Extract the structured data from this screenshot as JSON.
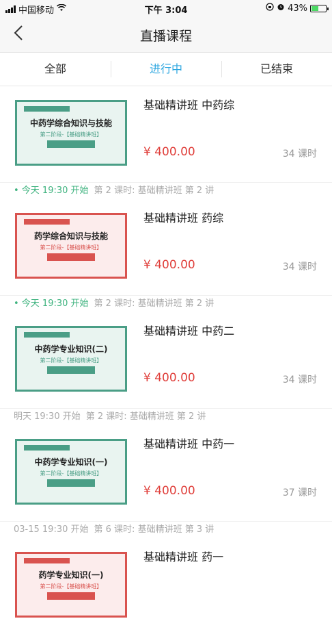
{
  "status_bar": {
    "carrier": "中国移动",
    "time": "下午 3:04",
    "battery": "43%"
  },
  "nav": {
    "title": "直播课程",
    "back_icon": "chevron-left-icon"
  },
  "tabs": [
    {
      "label": "全部"
    },
    {
      "label": "进行中"
    },
    {
      "label": "已结束"
    }
  ],
  "active_tab": "进行中",
  "colors": {
    "accent": "#2ea7e0",
    "price": "#e0403c",
    "live_today": "#3fb37f",
    "thumb_green": "#4a9e86",
    "thumb_red": "#d9534f"
  },
  "courses": [
    {
      "name": "基础精讲班 中药综",
      "price": "¥ 400.00",
      "hours": "34 课时",
      "thumb": {
        "subject": "中药学综合知识与技能",
        "stage": "第二阶段-【基础精讲班】",
        "color": "green"
      },
      "live": {
        "when": "• 今天 19:30 开始",
        "lesson": "第 2 课时: 基础精讲班 第 2 讲"
      }
    },
    {
      "name": "基础精讲班 药综",
      "price": "¥ 400.00",
      "hours": "34 课时",
      "thumb": {
        "subject": "药学综合知识与技能",
        "stage": "第二阶段-【基础精讲班】",
        "color": "red"
      },
      "live": {
        "when": "• 今天 19:30 开始",
        "lesson": "第 2 课时: 基础精讲班 第 2 讲"
      }
    },
    {
      "name": "基础精讲班 中药二",
      "price": "¥ 400.00",
      "hours": "34 课时",
      "thumb": {
        "subject": "中药学专业知识(二)",
        "stage": "第二阶段-【基础精讲班】",
        "color": "green"
      },
      "live": {
        "when": "明天 19:30 开始",
        "lesson": "第 2 课时: 基础精讲班 第 2 讲"
      }
    },
    {
      "name": "基础精讲班 中药一",
      "price": "¥ 400.00",
      "hours": "37 课时",
      "thumb": {
        "subject": "中药学专业知识(一)",
        "stage": "第二阶段-【基础精讲班】",
        "color": "green"
      },
      "live": {
        "when": "03-15 19:30 开始",
        "lesson": "第 6 课时: 基础精讲班 第 3 讲"
      }
    },
    {
      "name": "基础精讲班 药一",
      "price": "",
      "hours": "",
      "thumb": {
        "subject": "药学专业知识(一)",
        "stage": "第二阶段-【基础精讲班】",
        "color": "red"
      },
      "live": {
        "when": "",
        "lesson": ""
      }
    }
  ]
}
